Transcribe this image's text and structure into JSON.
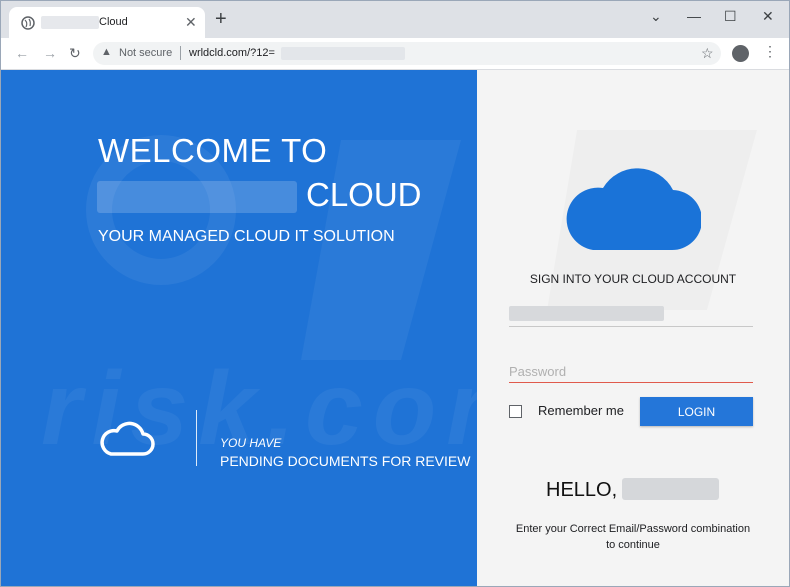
{
  "browser": {
    "tab_title": "Cloud",
    "new_tab": "+",
    "security_label": "Not secure",
    "url": "wrldcld.com/?12="
  },
  "hero": {
    "welcome_line1": "WELCOME TO",
    "welcome_line2": "CLOUD",
    "subtitle": "YOUR MANAGED CLOUD IT SOLUTION",
    "notice_small": "YOU HAVE",
    "notice_main": "PENDING DOCUMENTS FOR REVIEW",
    "watermark": "risk.com"
  },
  "login": {
    "heading": "SIGN INTO YOUR CLOUD ACCOUNT",
    "password_placeholder": "Password",
    "remember_label": "Remember me",
    "login_button": "LOGIN",
    "hello": "HELLO,",
    "message_line1": "Enter your Correct Email/Password combination",
    "message_line2": "to continue"
  },
  "colors": {
    "brand_blue": "#1f73d6",
    "cloud_blue": "#1a73d8",
    "password_underline": "#e05a4c"
  }
}
